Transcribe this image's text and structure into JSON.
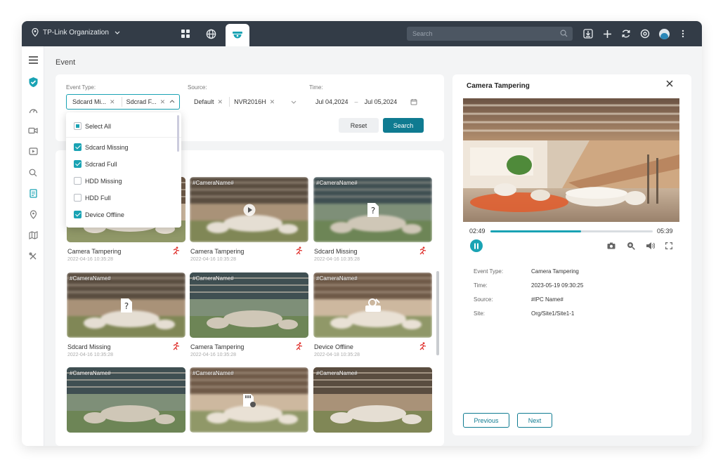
{
  "topbar": {
    "organization": "TP-Link Organization",
    "search_placeholder": "Search"
  },
  "page": {
    "title": "Event"
  },
  "filters": {
    "event_type_label": "Event Type:",
    "event_type_tags": [
      "Sdcard Mi...",
      "Sdcrad F..."
    ],
    "source_label": "Source:",
    "source_tags": [
      "Default",
      "NVR2016H"
    ],
    "time_label": "Time:",
    "time_start": "Jul 04,2024",
    "time_end": "Jul 05,2024",
    "time_sep": "–",
    "reset_label": "Reset",
    "search_label": "Search"
  },
  "dropdown": {
    "select_all": "Select All",
    "options": [
      {
        "label": "Sdcard Missing",
        "checked": true
      },
      {
        "label": "Sdcrad Full",
        "checked": true
      },
      {
        "label": "HDD Missing",
        "checked": false
      },
      {
        "label": "HDD Full",
        "checked": false
      },
      {
        "label": "Device Offline",
        "checked": true
      }
    ]
  },
  "events": [
    {
      "camera": "#CameraName#",
      "name": "Camera Tampering",
      "time": "2022-04-16 10:35:28"
    },
    {
      "camera": "#CameraName#",
      "name": "Camera Tampering",
      "time": "2022-04-16 10:35:28"
    },
    {
      "camera": "#CameraName#",
      "name": "Sdcard Missing",
      "time": "2022-04-16 10:35:28"
    },
    {
      "camera": "#CameraName#",
      "name": "Sdcard Missing",
      "time": "2022-04-16 10:35:28"
    },
    {
      "camera": "#CameraName#",
      "name": "Camera Tampering",
      "time": "2022-04-16 10:35:28"
    },
    {
      "camera": "#CameraName#",
      "name": "Device Offline",
      "time": "2022-04-18 10:35:28"
    },
    {
      "camera": "#CameraName#",
      "name": "",
      "time": ""
    },
    {
      "camera": "#CameraName#",
      "name": "",
      "time": ""
    },
    {
      "camera": "#CameraName#",
      "name": "",
      "time": ""
    }
  ],
  "detail": {
    "title": "Camera Tampering",
    "elapsed": "02:49",
    "duration": "05:39",
    "progress": 0.56,
    "info": [
      {
        "label": "Event Type:",
        "value": "Camera Tampering"
      },
      {
        "label": "Time:",
        "value": "2023-05-19  09:30:25"
      },
      {
        "label": "Source:",
        "value": "#IPC Name#"
      },
      {
        "label": "Site:",
        "value": "Org/Site1/Site1-1"
      }
    ],
    "previous_label": "Previous",
    "next_label": "Next"
  },
  "colors": {
    "accent": "#1aa3b4",
    "primary_button": "#0f7b91",
    "topbar": "#333c47",
    "alert_red": "#e0332f"
  }
}
